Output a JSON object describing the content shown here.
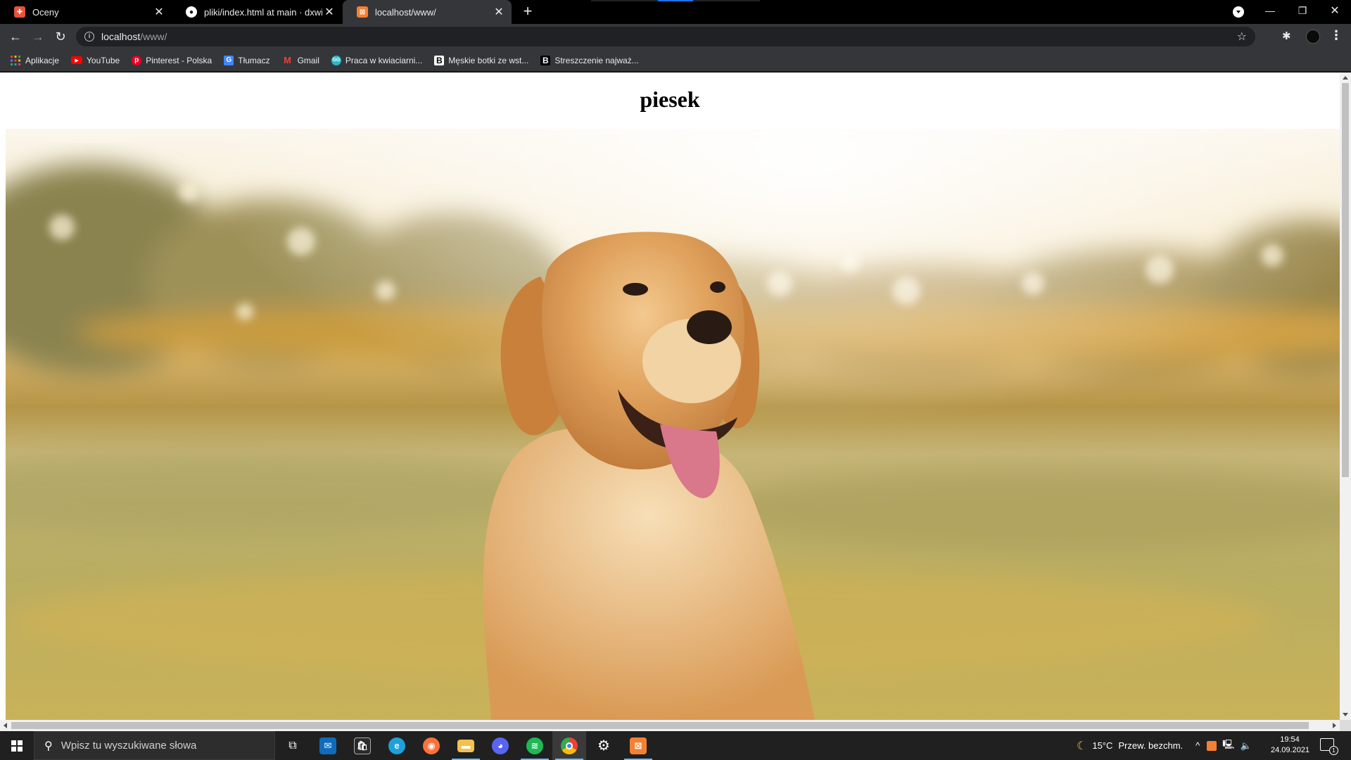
{
  "browser": {
    "tabs": [
      {
        "title": "Oceny",
        "active": false
      },
      {
        "title": "pliki/index.html at main · dxwilk/p",
        "active": false
      },
      {
        "title": "localhost/www/",
        "active": true
      }
    ],
    "address": {
      "host": "localhost",
      "path": "/www/"
    },
    "bookmarks": [
      {
        "label": "Aplikacje",
        "icon": "apps-grid-icon"
      },
      {
        "label": "YouTube",
        "icon": "youtube-icon"
      },
      {
        "label": "Pinterest - Polska",
        "icon": "pinterest-icon"
      },
      {
        "label": "Tłumacz",
        "icon": "translate-icon"
      },
      {
        "label": "Gmail",
        "icon": "gmail-icon"
      },
      {
        "label": "Praca w kwiaciarni...",
        "icon": "job-site-icon"
      },
      {
        "label": "Męskie botki ze wst...",
        "icon": "b-site-icon"
      },
      {
        "label": "Streszczenie najważ...",
        "icon": "b-site-icon"
      }
    ]
  },
  "page": {
    "heading": "piesek",
    "image_alt": "golden retriever in a sunny meadow"
  },
  "taskbar": {
    "search_placeholder": "Wpisz tu wyszukiwane słowa",
    "weather_temp": "15°C",
    "weather_desc": "Przew. bezchm.",
    "time": "19:54",
    "date": "24.09.2021",
    "notification_count": "1",
    "apps": [
      "task-view-icon",
      "mail-icon",
      "store-icon",
      "edge-icon",
      "firefox-icon",
      "file-explorer-icon",
      "discord-icon",
      "spotify-icon",
      "chrome-icon",
      "settings-icon",
      "xampp-icon"
    ]
  },
  "colors": {
    "tab_bg": "#000000",
    "toolbar_bg": "#35363a",
    "omnibox_bg": "#202124",
    "taskbar_bg": "#202020",
    "page_bg": "#ffffff"
  }
}
